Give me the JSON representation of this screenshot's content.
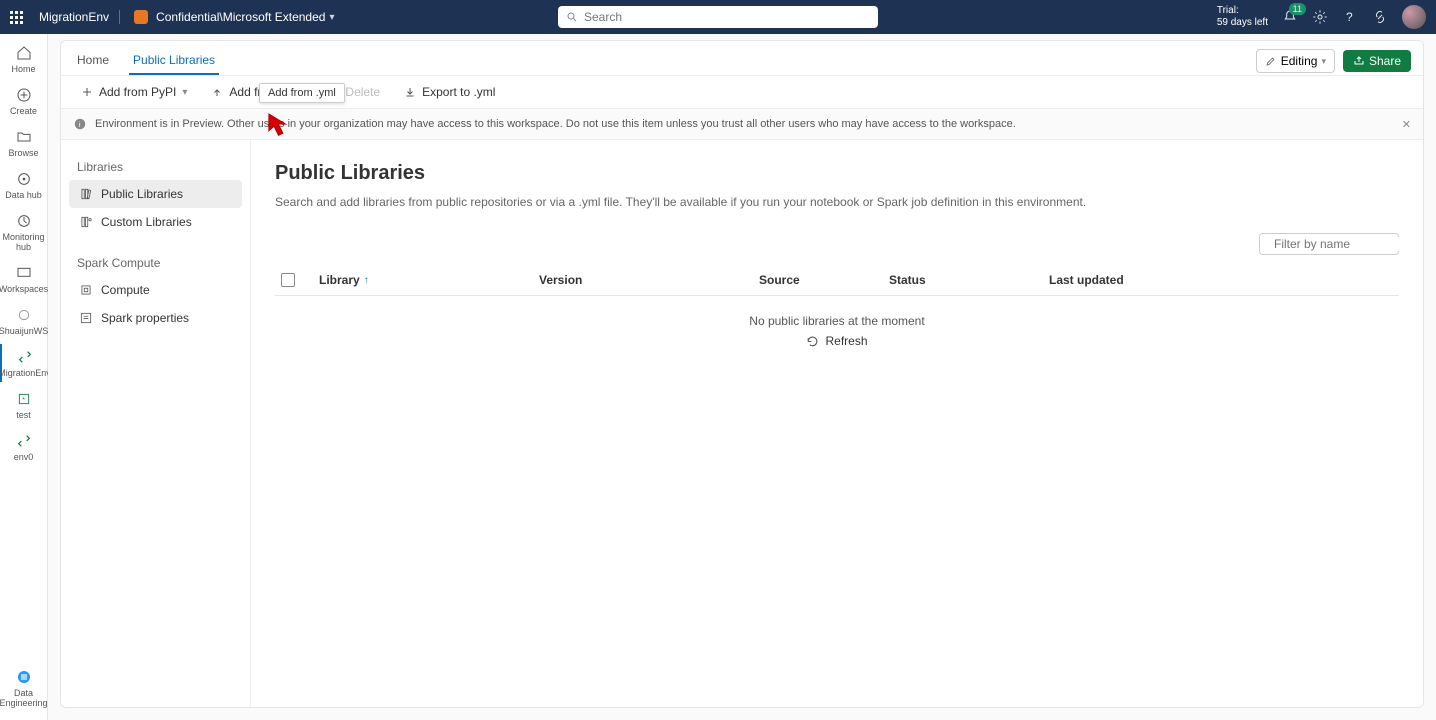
{
  "header": {
    "env_name": "MigrationEnv",
    "workspace_path": "Confidential\\Microsoft Extended",
    "search_placeholder": "Search",
    "trial_line1": "Trial:",
    "trial_line2": "59 days left",
    "notifications_count": "11"
  },
  "left_rail": {
    "items": [
      {
        "label": "Home"
      },
      {
        "label": "Create"
      },
      {
        "label": "Browse"
      },
      {
        "label": "Data hub"
      },
      {
        "label": "Monitoring hub"
      },
      {
        "label": "Workspaces"
      },
      {
        "label": "ShuaijunWS"
      },
      {
        "label": "MigrationEnv"
      },
      {
        "label": "test"
      },
      {
        "label": "env0"
      }
    ],
    "bottom_label": "Data Engineering"
  },
  "tabs": {
    "home": "Home",
    "public_libraries": "Public Libraries",
    "editing_label": "Editing",
    "share_label": "Share",
    "tooltip": "Add from .yml"
  },
  "toolbar": {
    "add_pypi": "Add from PyPI",
    "add_yml": "Add from .yml",
    "delete": "Delete",
    "export_yml": "Export to .yml"
  },
  "banner": {
    "text": "Environment is in Preview. Other users in your organization may have access to this workspace. Do not use this item unless you trust all other users who may have access to the workspace."
  },
  "side": {
    "libraries_title": "Libraries",
    "public": "Public Libraries",
    "custom": "Custom Libraries",
    "spark_title": "Spark Compute",
    "compute": "Compute",
    "spark_props": "Spark properties"
  },
  "detail": {
    "title": "Public Libraries",
    "description": "Search and add libraries from public repositories or via a .yml file. They'll be available if you run your notebook or Spark job definition in this environment.",
    "filter_placeholder": "Filter by name",
    "columns": {
      "library": "Library",
      "version": "Version",
      "source": "Source",
      "status": "Status",
      "last_updated": "Last updated"
    },
    "empty_msg": "No public libraries at the moment",
    "refresh": "Refresh"
  }
}
